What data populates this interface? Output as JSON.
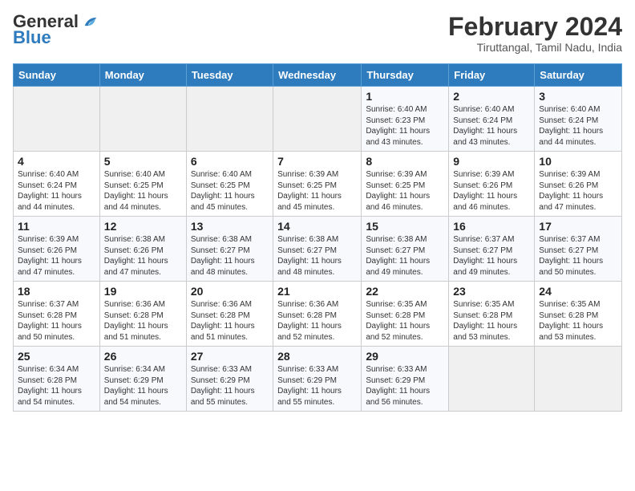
{
  "logo": {
    "general": "General",
    "blue": "Blue"
  },
  "title": "February 2024",
  "location": "Tiruttangal, Tamil Nadu, India",
  "days_of_week": [
    "Sunday",
    "Monday",
    "Tuesday",
    "Wednesday",
    "Thursday",
    "Friday",
    "Saturday"
  ],
  "weeks": [
    [
      {
        "day": "",
        "sunrise": "",
        "sunset": "",
        "daylight": ""
      },
      {
        "day": "",
        "sunrise": "",
        "sunset": "",
        "daylight": ""
      },
      {
        "day": "",
        "sunrise": "",
        "sunset": "",
        "daylight": ""
      },
      {
        "day": "",
        "sunrise": "",
        "sunset": "",
        "daylight": ""
      },
      {
        "day": "1",
        "sunrise": "Sunrise: 6:40 AM",
        "sunset": "Sunset: 6:23 PM",
        "daylight": "Daylight: 11 hours and 43 minutes."
      },
      {
        "day": "2",
        "sunrise": "Sunrise: 6:40 AM",
        "sunset": "Sunset: 6:24 PM",
        "daylight": "Daylight: 11 hours and 43 minutes."
      },
      {
        "day": "3",
        "sunrise": "Sunrise: 6:40 AM",
        "sunset": "Sunset: 6:24 PM",
        "daylight": "Daylight: 11 hours and 44 minutes."
      }
    ],
    [
      {
        "day": "4",
        "sunrise": "Sunrise: 6:40 AM",
        "sunset": "Sunset: 6:24 PM",
        "daylight": "Daylight: 11 hours and 44 minutes."
      },
      {
        "day": "5",
        "sunrise": "Sunrise: 6:40 AM",
        "sunset": "Sunset: 6:25 PM",
        "daylight": "Daylight: 11 hours and 44 minutes."
      },
      {
        "day": "6",
        "sunrise": "Sunrise: 6:40 AM",
        "sunset": "Sunset: 6:25 PM",
        "daylight": "Daylight: 11 hours and 45 minutes."
      },
      {
        "day": "7",
        "sunrise": "Sunrise: 6:39 AM",
        "sunset": "Sunset: 6:25 PM",
        "daylight": "Daylight: 11 hours and 45 minutes."
      },
      {
        "day": "8",
        "sunrise": "Sunrise: 6:39 AM",
        "sunset": "Sunset: 6:25 PM",
        "daylight": "Daylight: 11 hours and 46 minutes."
      },
      {
        "day": "9",
        "sunrise": "Sunrise: 6:39 AM",
        "sunset": "Sunset: 6:26 PM",
        "daylight": "Daylight: 11 hours and 46 minutes."
      },
      {
        "day": "10",
        "sunrise": "Sunrise: 6:39 AM",
        "sunset": "Sunset: 6:26 PM",
        "daylight": "Daylight: 11 hours and 47 minutes."
      }
    ],
    [
      {
        "day": "11",
        "sunrise": "Sunrise: 6:39 AM",
        "sunset": "Sunset: 6:26 PM",
        "daylight": "Daylight: 11 hours and 47 minutes."
      },
      {
        "day": "12",
        "sunrise": "Sunrise: 6:38 AM",
        "sunset": "Sunset: 6:26 PM",
        "daylight": "Daylight: 11 hours and 47 minutes."
      },
      {
        "day": "13",
        "sunrise": "Sunrise: 6:38 AM",
        "sunset": "Sunset: 6:27 PM",
        "daylight": "Daylight: 11 hours and 48 minutes."
      },
      {
        "day": "14",
        "sunrise": "Sunrise: 6:38 AM",
        "sunset": "Sunset: 6:27 PM",
        "daylight": "Daylight: 11 hours and 48 minutes."
      },
      {
        "day": "15",
        "sunrise": "Sunrise: 6:38 AM",
        "sunset": "Sunset: 6:27 PM",
        "daylight": "Daylight: 11 hours and 49 minutes."
      },
      {
        "day": "16",
        "sunrise": "Sunrise: 6:37 AM",
        "sunset": "Sunset: 6:27 PM",
        "daylight": "Daylight: 11 hours and 49 minutes."
      },
      {
        "day": "17",
        "sunrise": "Sunrise: 6:37 AM",
        "sunset": "Sunset: 6:27 PM",
        "daylight": "Daylight: 11 hours and 50 minutes."
      }
    ],
    [
      {
        "day": "18",
        "sunrise": "Sunrise: 6:37 AM",
        "sunset": "Sunset: 6:28 PM",
        "daylight": "Daylight: 11 hours and 50 minutes."
      },
      {
        "day": "19",
        "sunrise": "Sunrise: 6:36 AM",
        "sunset": "Sunset: 6:28 PM",
        "daylight": "Daylight: 11 hours and 51 minutes."
      },
      {
        "day": "20",
        "sunrise": "Sunrise: 6:36 AM",
        "sunset": "Sunset: 6:28 PM",
        "daylight": "Daylight: 11 hours and 51 minutes."
      },
      {
        "day": "21",
        "sunrise": "Sunrise: 6:36 AM",
        "sunset": "Sunset: 6:28 PM",
        "daylight": "Daylight: 11 hours and 52 minutes."
      },
      {
        "day": "22",
        "sunrise": "Sunrise: 6:35 AM",
        "sunset": "Sunset: 6:28 PM",
        "daylight": "Daylight: 11 hours and 52 minutes."
      },
      {
        "day": "23",
        "sunrise": "Sunrise: 6:35 AM",
        "sunset": "Sunset: 6:28 PM",
        "daylight": "Daylight: 11 hours and 53 minutes."
      },
      {
        "day": "24",
        "sunrise": "Sunrise: 6:35 AM",
        "sunset": "Sunset: 6:28 PM",
        "daylight": "Daylight: 11 hours and 53 minutes."
      }
    ],
    [
      {
        "day": "25",
        "sunrise": "Sunrise: 6:34 AM",
        "sunset": "Sunset: 6:28 PM",
        "daylight": "Daylight: 11 hours and 54 minutes."
      },
      {
        "day": "26",
        "sunrise": "Sunrise: 6:34 AM",
        "sunset": "Sunset: 6:29 PM",
        "daylight": "Daylight: 11 hours and 54 minutes."
      },
      {
        "day": "27",
        "sunrise": "Sunrise: 6:33 AM",
        "sunset": "Sunset: 6:29 PM",
        "daylight": "Daylight: 11 hours and 55 minutes."
      },
      {
        "day": "28",
        "sunrise": "Sunrise: 6:33 AM",
        "sunset": "Sunset: 6:29 PM",
        "daylight": "Daylight: 11 hours and 55 minutes."
      },
      {
        "day": "29",
        "sunrise": "Sunrise: 6:33 AM",
        "sunset": "Sunset: 6:29 PM",
        "daylight": "Daylight: 11 hours and 56 minutes."
      },
      {
        "day": "",
        "sunrise": "",
        "sunset": "",
        "daylight": ""
      },
      {
        "day": "",
        "sunrise": "",
        "sunset": "",
        "daylight": ""
      }
    ]
  ]
}
